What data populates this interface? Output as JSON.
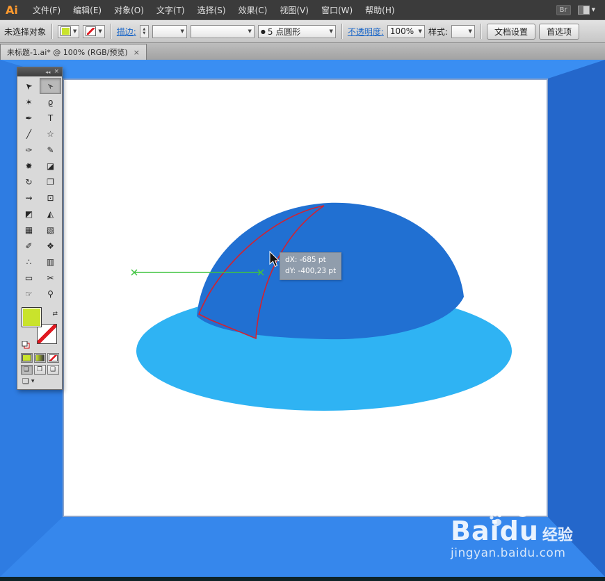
{
  "menu": {
    "logo": "Ai",
    "items": [
      "文件(F)",
      "编辑(E)",
      "对象(O)",
      "文字(T)",
      "选择(S)",
      "效果(C)",
      "视图(V)",
      "窗口(W)",
      "帮助(H)"
    ],
    "bridge": "Br"
  },
  "icons": {
    "caret": "▼",
    "spin_up": "▲",
    "spin_down": "▼",
    "swap": "⇄",
    "collapse": "◂◂",
    "close": "×"
  },
  "control_bar": {
    "no_selection": "未选择对象",
    "stroke_label": "描边:",
    "brush_bullet": "●",
    "brush_name": "5 点圆形",
    "opacity_label": "不透明度:",
    "opacity_value": "100%",
    "style_label": "样式:",
    "doc_setup": "文档设置",
    "preferences": "首选项"
  },
  "tab": {
    "title": "未标题-1.ai* @ 100% (RGB/预览)",
    "close": "×"
  },
  "toolbar": {
    "tools": [
      {
        "name": "selection",
        "glyph": "➤"
      },
      {
        "name": "direct-selection",
        "glyph": "➢"
      },
      {
        "name": "magic-wand",
        "glyph": "✶"
      },
      {
        "name": "lasso",
        "glyph": "ϱ"
      },
      {
        "name": "pen",
        "glyph": "✒"
      },
      {
        "name": "type",
        "glyph": "T"
      },
      {
        "name": "line",
        "glyph": "╱"
      },
      {
        "name": "shape",
        "glyph": "☆"
      },
      {
        "name": "paintbrush",
        "glyph": "✑"
      },
      {
        "name": "pencil",
        "glyph": "✎"
      },
      {
        "name": "blob-brush",
        "glyph": "✹"
      },
      {
        "name": "eraser",
        "glyph": "◪"
      },
      {
        "name": "rotate",
        "glyph": "↻"
      },
      {
        "name": "scale",
        "glyph": "❐"
      },
      {
        "name": "width",
        "glyph": "⇝"
      },
      {
        "name": "free-transform",
        "glyph": "⊡"
      },
      {
        "name": "shape-builder",
        "glyph": "◩"
      },
      {
        "name": "perspective-grid",
        "glyph": "◭"
      },
      {
        "name": "mesh",
        "glyph": "▦"
      },
      {
        "name": "gradient",
        "glyph": "▧"
      },
      {
        "name": "eyedropper",
        "glyph": "✐"
      },
      {
        "name": "blend",
        "glyph": "❖"
      },
      {
        "name": "symbol-sprayer",
        "glyph": "∴"
      },
      {
        "name": "graph",
        "glyph": "▥"
      },
      {
        "name": "artboard",
        "glyph": "▭"
      },
      {
        "name": "slice",
        "glyph": "✂"
      },
      {
        "name": "hand",
        "glyph": "☞"
      },
      {
        "name": "zoom",
        "glyph": "⚲"
      }
    ],
    "modes": [
      "❏",
      "❐",
      "❑"
    ],
    "screen_mode": "❏"
  },
  "canvas": {
    "tooltip_dx": "dX: -685 pt",
    "tooltip_dy": "dY: -400,23 pt"
  },
  "watermark": {
    "brand": "Baidu",
    "suffix": "经验",
    "url": "jingyan.baidu.com"
  },
  "colors": {
    "fill_swatch": "#c9e32c",
    "gradient_swatch": "linear-gradient(90deg,#c9e32c,#3a3a3a)",
    "dome": "#2170d2",
    "brim": "#2fb3f3",
    "outline_red": "#d5212e",
    "guide_green": "#3fc43f",
    "frame_top": "#3a8ef2",
    "frame_left": "#2e7ce2",
    "frame_right": "#2467cb",
    "frame_bottom": "#3687ec"
  }
}
